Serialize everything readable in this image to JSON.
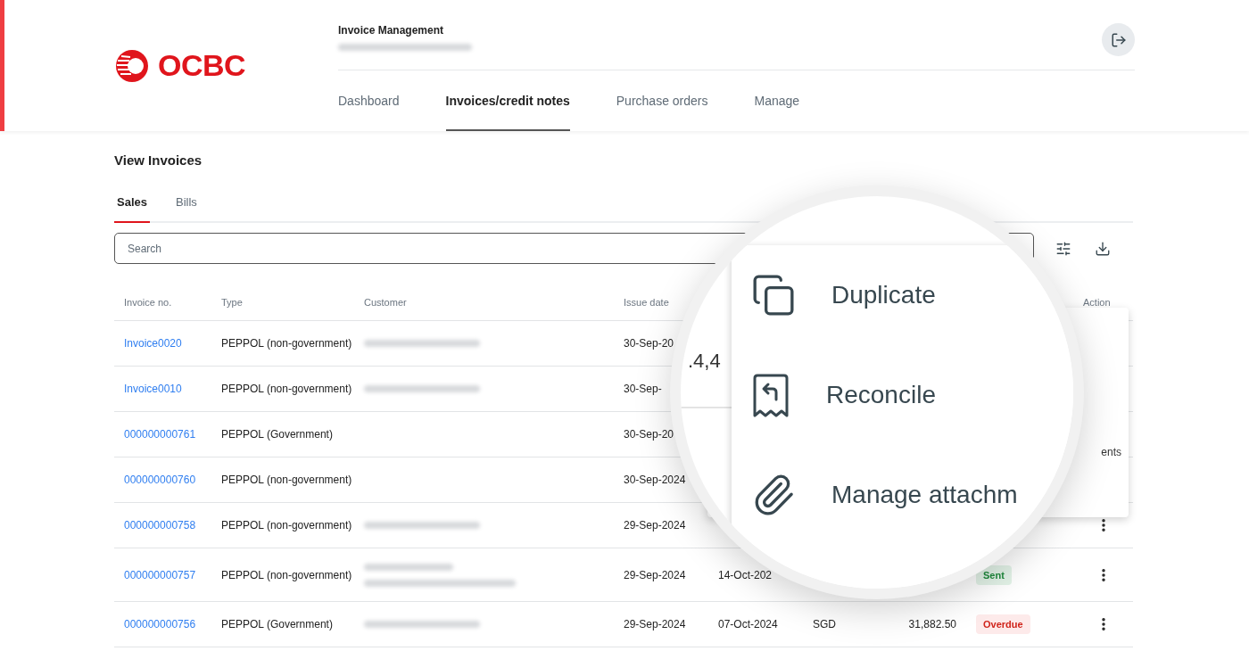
{
  "header": {
    "logo_text": "OCBC",
    "app_title": "Invoice Management",
    "subtitle_redacted": true,
    "nav": [
      {
        "label": "Dashboard",
        "selected": false
      },
      {
        "label": "Invoices/credit notes",
        "selected": true
      },
      {
        "label": "Purchase orders",
        "selected": false
      },
      {
        "label": "Manage",
        "selected": false
      }
    ]
  },
  "page_title": "View Invoices",
  "tabs": [
    {
      "label": "Sales",
      "selected": true
    },
    {
      "label": "Bills",
      "selected": false
    }
  ],
  "search": {
    "placeholder": "Search"
  },
  "table": {
    "columns": [
      "Invoice no.",
      "Type",
      "Customer",
      "Issue date",
      "",
      "",
      "",
      "",
      "Action"
    ],
    "rows": [
      {
        "invoice_no": "Invoice0020",
        "type": "PEPPOL (non-government)",
        "customer_redacted": true,
        "customer_two_line": false,
        "issue_date": "30-Sep-20",
        "has_action_menu": false
      },
      {
        "invoice_no": "Invoice0010",
        "type": "PEPPOL (non-government)",
        "customer_redacted": true,
        "customer_two_line": false,
        "issue_date": "30-Sep-",
        "has_action_menu": false
      },
      {
        "invoice_no": "000000000761",
        "type": "PEPPOL (Government)",
        "customer_redacted": false,
        "customer_two_line": false,
        "issue_date": "30-Sep-20",
        "has_action_menu": false
      },
      {
        "invoice_no": "000000000760",
        "type": "PEPPOL (non-government)",
        "customer_redacted": false,
        "customer_two_line": false,
        "issue_date": "30-Sep-2024",
        "has_action_menu": false
      },
      {
        "invoice_no": "000000000758",
        "type": "PEPPOL (non-government)",
        "customer_redacted": true,
        "customer_two_line": false,
        "issue_date": "29-Sep-2024",
        "has_action_menu": true
      },
      {
        "invoice_no": "000000000757",
        "type": "PEPPOL (non-government)",
        "customer_redacted": true,
        "customer_two_line": true,
        "issue_date": "29-Sep-2024",
        "due_date": "14-Oct-202",
        "status": {
          "label": "Sent",
          "kind": "sent"
        },
        "has_action_menu": true
      },
      {
        "invoice_no": "000000000756",
        "type": "PEPPOL (Government)",
        "customer_redacted": true,
        "customer_two_line": false,
        "issue_date": "29-Sep-2024",
        "due_date": "07-Oct-2024",
        "currency": "SGD",
        "amount": "31,882.50",
        "status": {
          "label": "Overdue",
          "kind": "overdue"
        },
        "has_action_menu": true
      }
    ]
  },
  "action_menu": {
    "visible_fragment": "ents"
  },
  "magnifier": {
    "fragment": ".4,4",
    "items": [
      {
        "label": "Duplicate",
        "kind": "duplicate"
      },
      {
        "label": "Reconcile",
        "kind": "reconcile"
      },
      {
        "label": "Manage attachm",
        "kind": "attachment"
      }
    ]
  }
}
